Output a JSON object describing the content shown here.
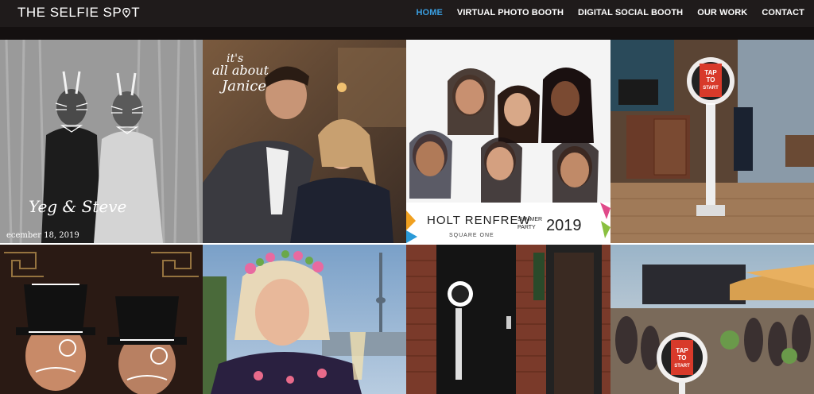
{
  "brand": {
    "name_left": "THE SELFIE SP",
    "name_right": "T"
  },
  "nav": {
    "items": [
      {
        "label": "HOME",
        "active": true
      },
      {
        "label": "VIRTUAL PHOTO BOOTH",
        "active": false
      },
      {
        "label": "DIGITAL SOCIAL BOOTH",
        "active": false
      },
      {
        "label": "OUR WORK",
        "active": false
      },
      {
        "label": "CONTACT",
        "active": false
      }
    ]
  },
  "colors": {
    "nav_bg": "#1f1b1b",
    "active": "#3a9ee0",
    "band": "#141010"
  },
  "gallery": {
    "tile1": {
      "script": "Yeg & Steve",
      "date": "ecember 18, 2019"
    },
    "tile2": {
      "script_line1": "it's",
      "script_line2": "all about",
      "script_line3": "Janice"
    },
    "tile3": {
      "brand": "HOLT RENFREW",
      "sub": "SQUARE ONE",
      "event_line1": "SUMMER",
      "event_line2": "PARTY",
      "year": "2019"
    },
    "tile4": {
      "screen_text_1": "TAP",
      "screen_text_2": "TO",
      "screen_text_3": "START"
    },
    "tile8": {
      "screen_text_1": "TAP",
      "screen_text_2": "TO",
      "screen_text_3": "START"
    }
  }
}
